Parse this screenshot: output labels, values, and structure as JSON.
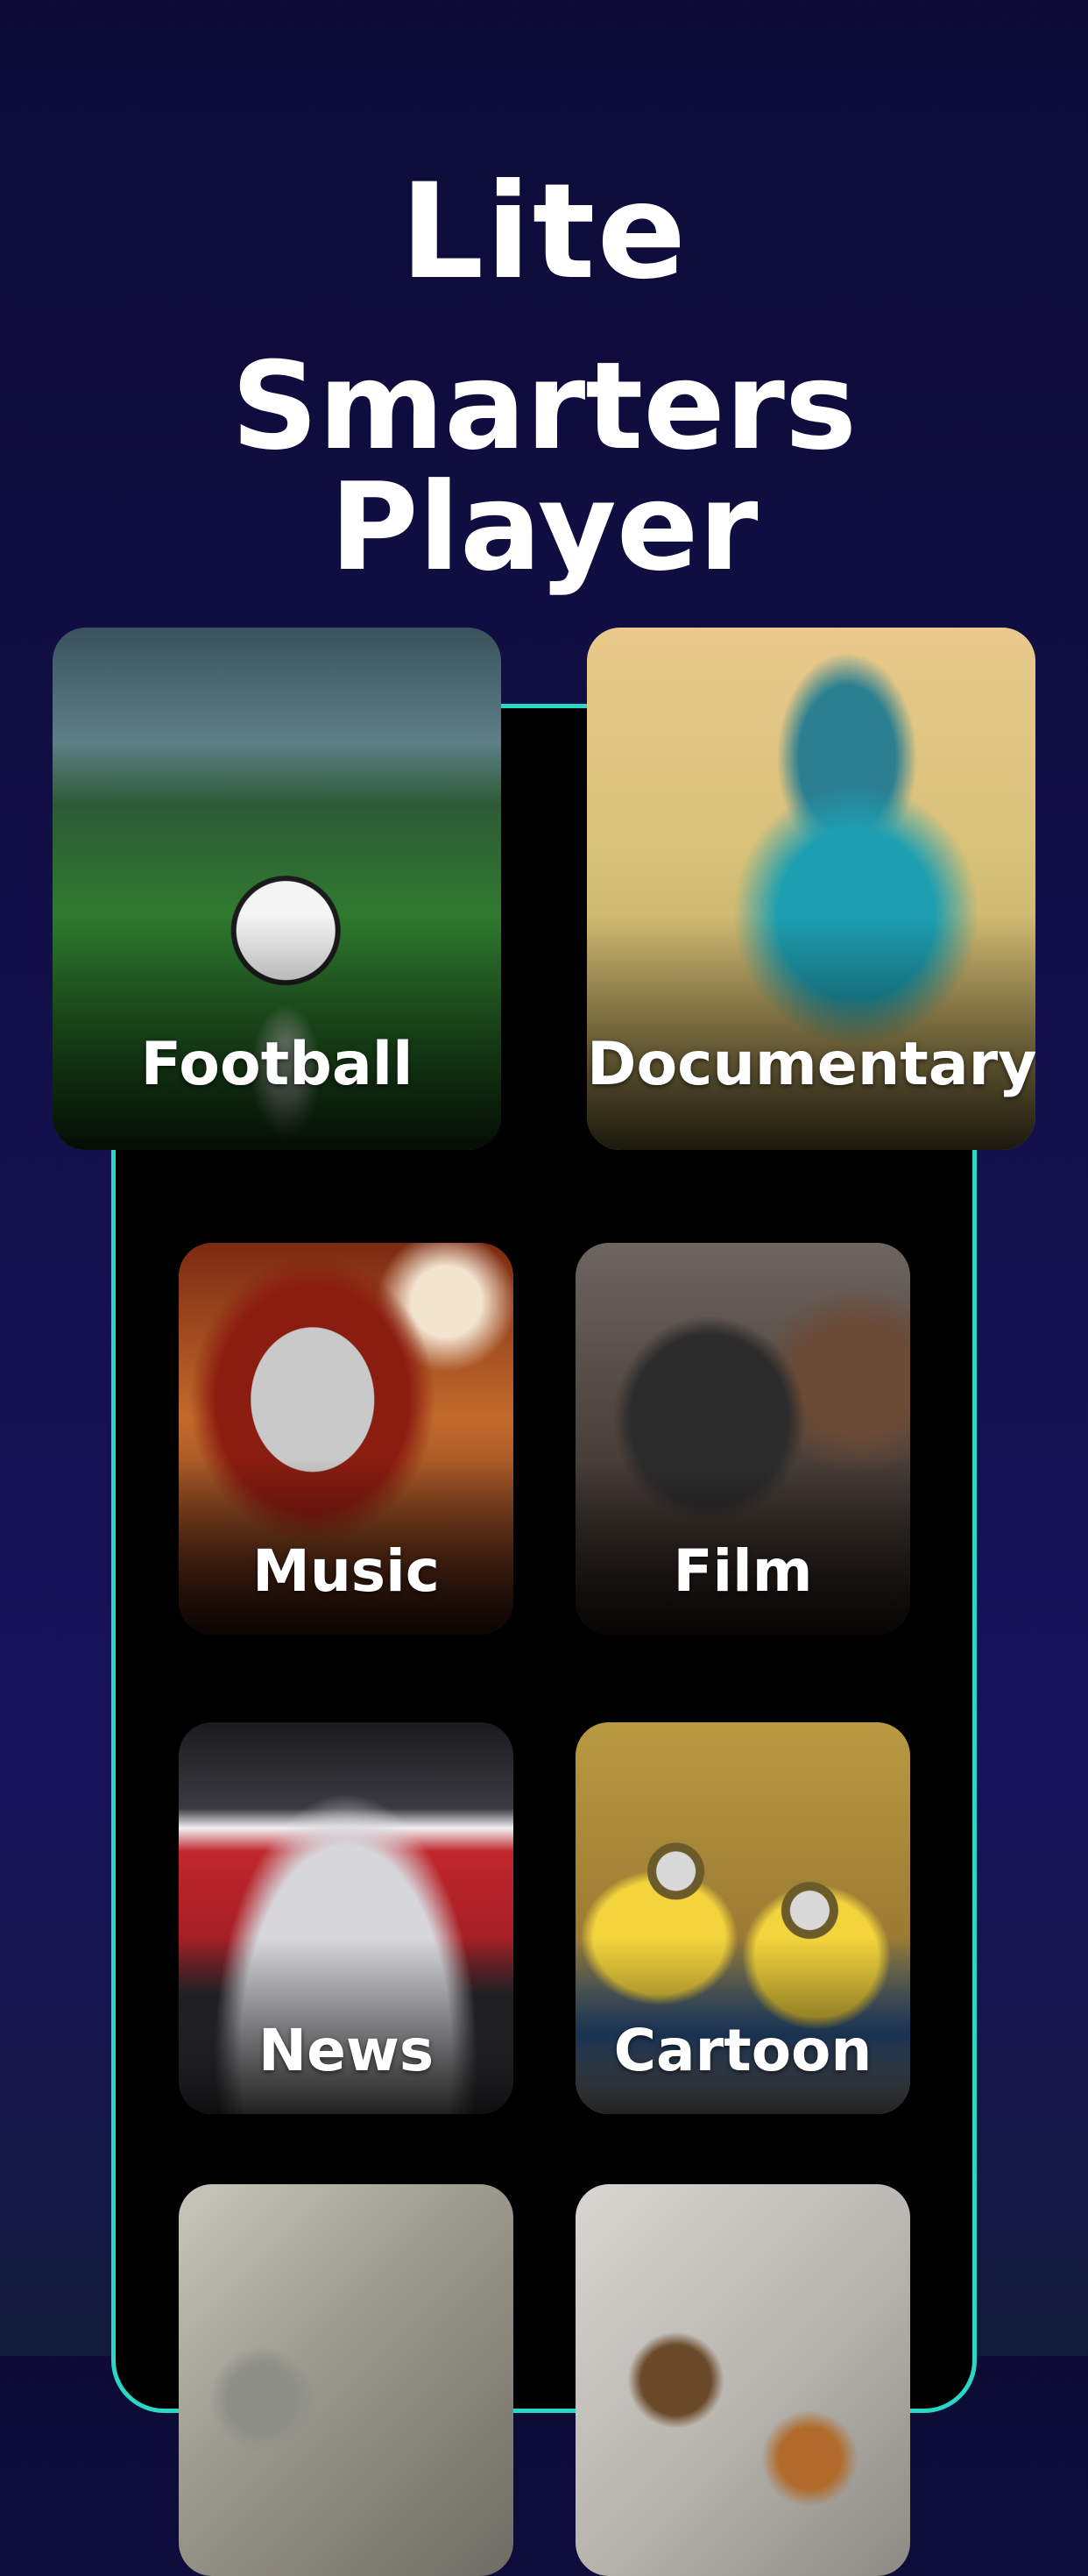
{
  "header": {
    "line1": "Lite",
    "line2": "Smarters Player"
  },
  "categories": [
    {
      "label": "Football"
    },
    {
      "label": "Documentary"
    },
    {
      "label": "Music"
    },
    {
      "label": "Film"
    },
    {
      "label": "News"
    },
    {
      "label": "Cartoon"
    },
    {
      "label": ""
    },
    {
      "label": ""
    }
  ],
  "colors": {
    "background": "#0d0b36",
    "phone_border": "#2ad6c4",
    "text": "#ffffff"
  }
}
